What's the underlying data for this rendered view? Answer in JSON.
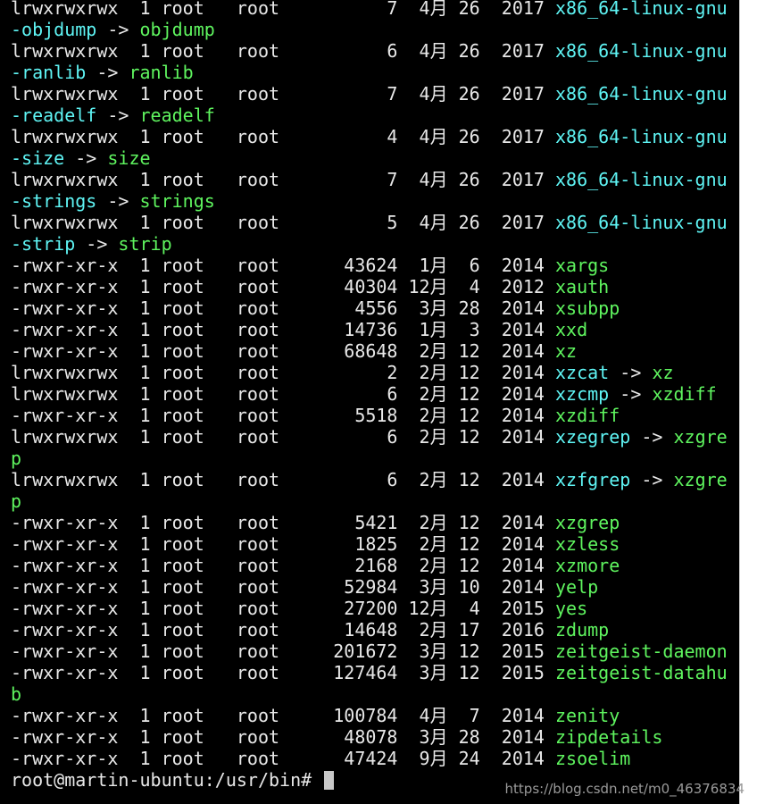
{
  "terminal": {
    "lines": [
      {
        "segments": [
          {
            "text": "lrwxrwxrwx  1 root   root          7  4月 26  2017 ",
            "color": "plain"
          },
          {
            "text": "x86_64-linux-gnu",
            "color": "cyan"
          }
        ]
      },
      {
        "segments": [
          {
            "text": "-objdump",
            "color": "cyan"
          },
          {
            "text": " -> ",
            "color": "plain"
          },
          {
            "text": "objdump",
            "color": "green"
          }
        ]
      },
      {
        "segments": [
          {
            "text": "lrwxrwxrwx  1 root   root          6  4月 26  2017 ",
            "color": "plain"
          },
          {
            "text": "x86_64-linux-gnu",
            "color": "cyan"
          }
        ]
      },
      {
        "segments": [
          {
            "text": "-ranlib",
            "color": "cyan"
          },
          {
            "text": " -> ",
            "color": "plain"
          },
          {
            "text": "ranlib",
            "color": "green"
          }
        ]
      },
      {
        "segments": [
          {
            "text": "lrwxrwxrwx  1 root   root          7  4月 26  2017 ",
            "color": "plain"
          },
          {
            "text": "x86_64-linux-gnu",
            "color": "cyan"
          }
        ]
      },
      {
        "segments": [
          {
            "text": "-readelf",
            "color": "cyan"
          },
          {
            "text": " -> ",
            "color": "plain"
          },
          {
            "text": "readelf",
            "color": "green"
          }
        ]
      },
      {
        "segments": [
          {
            "text": "lrwxrwxrwx  1 root   root          4  4月 26  2017 ",
            "color": "plain"
          },
          {
            "text": "x86_64-linux-gnu",
            "color": "cyan"
          }
        ]
      },
      {
        "segments": [
          {
            "text": "-size",
            "color": "cyan"
          },
          {
            "text": " -> ",
            "color": "plain"
          },
          {
            "text": "size",
            "color": "green"
          }
        ]
      },
      {
        "segments": [
          {
            "text": "lrwxrwxrwx  1 root   root          7  4月 26  2017 ",
            "color": "plain"
          },
          {
            "text": "x86_64-linux-gnu",
            "color": "cyan"
          }
        ]
      },
      {
        "segments": [
          {
            "text": "-strings",
            "color": "cyan"
          },
          {
            "text": " -> ",
            "color": "plain"
          },
          {
            "text": "strings",
            "color": "green"
          }
        ]
      },
      {
        "segments": [
          {
            "text": "lrwxrwxrwx  1 root   root          5  4月 26  2017 ",
            "color": "plain"
          },
          {
            "text": "x86_64-linux-gnu",
            "color": "cyan"
          }
        ]
      },
      {
        "segments": [
          {
            "text": "-strip",
            "color": "cyan"
          },
          {
            "text": " -> ",
            "color": "plain"
          },
          {
            "text": "strip",
            "color": "green"
          }
        ]
      },
      {
        "segments": [
          {
            "text": "-rwxr-xr-x  1 root   root      43624  1月  6  2014 ",
            "color": "plain"
          },
          {
            "text": "xargs",
            "color": "green"
          }
        ]
      },
      {
        "segments": [
          {
            "text": "-rwxr-xr-x  1 root   root      40304 12月  4  2012 ",
            "color": "plain"
          },
          {
            "text": "xauth",
            "color": "green"
          }
        ]
      },
      {
        "segments": [
          {
            "text": "-rwxr-xr-x  1 root   root       4556  3月 28  2014 ",
            "color": "plain"
          },
          {
            "text": "xsubpp",
            "color": "green"
          }
        ]
      },
      {
        "segments": [
          {
            "text": "-rwxr-xr-x  1 root   root      14736  1月  3  2014 ",
            "color": "plain"
          },
          {
            "text": "xxd",
            "color": "green"
          }
        ]
      },
      {
        "segments": [
          {
            "text": "-rwxr-xr-x  1 root   root      68648  2月 12  2014 ",
            "color": "plain"
          },
          {
            "text": "xz",
            "color": "green"
          }
        ]
      },
      {
        "segments": [
          {
            "text": "lrwxrwxrwx  1 root   root          2  2月 12  2014 ",
            "color": "plain"
          },
          {
            "text": "xzcat",
            "color": "cyan"
          },
          {
            "text": " -> ",
            "color": "plain"
          },
          {
            "text": "xz",
            "color": "green"
          }
        ]
      },
      {
        "segments": [
          {
            "text": "lrwxrwxrwx  1 root   root          6  2月 12  2014 ",
            "color": "plain"
          },
          {
            "text": "xzcmp",
            "color": "cyan"
          },
          {
            "text": " -> ",
            "color": "plain"
          },
          {
            "text": "xzdiff",
            "color": "green"
          }
        ]
      },
      {
        "segments": [
          {
            "text": "-rwxr-xr-x  1 root   root       5518  2月 12  2014 ",
            "color": "plain"
          },
          {
            "text": "xzdiff",
            "color": "green"
          }
        ]
      },
      {
        "segments": [
          {
            "text": "lrwxrwxrwx  1 root   root          6  2月 12  2014 ",
            "color": "plain"
          },
          {
            "text": "xzegrep",
            "color": "cyan"
          },
          {
            "text": " -> ",
            "color": "plain"
          },
          {
            "text": "xzgre",
            "color": "green"
          }
        ]
      },
      {
        "segments": [
          {
            "text": "p",
            "color": "green"
          }
        ]
      },
      {
        "segments": [
          {
            "text": "lrwxrwxrwx  1 root   root          6  2月 12  2014 ",
            "color": "plain"
          },
          {
            "text": "xzfgrep",
            "color": "cyan"
          },
          {
            "text": " -> ",
            "color": "plain"
          },
          {
            "text": "xzgre",
            "color": "green"
          }
        ]
      },
      {
        "segments": [
          {
            "text": "p",
            "color": "green"
          }
        ]
      },
      {
        "segments": [
          {
            "text": "-rwxr-xr-x  1 root   root       5421  2月 12  2014 ",
            "color": "plain"
          },
          {
            "text": "xzgrep",
            "color": "green"
          }
        ]
      },
      {
        "segments": [
          {
            "text": "-rwxr-xr-x  1 root   root       1825  2月 12  2014 ",
            "color": "plain"
          },
          {
            "text": "xzless",
            "color": "green"
          }
        ]
      },
      {
        "segments": [
          {
            "text": "-rwxr-xr-x  1 root   root       2168  2月 12  2014 ",
            "color": "plain"
          },
          {
            "text": "xzmore",
            "color": "green"
          }
        ]
      },
      {
        "segments": [
          {
            "text": "-rwxr-xr-x  1 root   root      52984  3月 10  2014 ",
            "color": "plain"
          },
          {
            "text": "yelp",
            "color": "green"
          }
        ]
      },
      {
        "segments": [
          {
            "text": "-rwxr-xr-x  1 root   root      27200 12月  4  2015 ",
            "color": "plain"
          },
          {
            "text": "yes",
            "color": "green"
          }
        ]
      },
      {
        "segments": [
          {
            "text": "-rwxr-xr-x  1 root   root      14648  2月 17  2016 ",
            "color": "plain"
          },
          {
            "text": "zdump",
            "color": "green"
          }
        ]
      },
      {
        "segments": [
          {
            "text": "-rwxr-xr-x  1 root   root     201672  3月 12  2015 ",
            "color": "plain"
          },
          {
            "text": "zeitgeist-daemon",
            "color": "green"
          }
        ]
      },
      {
        "segments": [
          {
            "text": "-rwxr-xr-x  1 root   root     127464  3月 12  2015 ",
            "color": "plain"
          },
          {
            "text": "zeitgeist-datahu",
            "color": "green"
          }
        ]
      },
      {
        "segments": [
          {
            "text": "b",
            "color": "green"
          }
        ]
      },
      {
        "segments": [
          {
            "text": "-rwxr-xr-x  1 root   root     100784  4月  7  2014 ",
            "color": "plain"
          },
          {
            "text": "zenity",
            "color": "green"
          }
        ]
      },
      {
        "segments": [
          {
            "text": "-rwxr-xr-x  1 root   root      48078  3月 28  2014 ",
            "color": "plain"
          },
          {
            "text": "zipdetails",
            "color": "green"
          }
        ]
      },
      {
        "segments": [
          {
            "text": "-rwxr-xr-x  1 root   root      47424  9月 24  2014 ",
            "color": "plain"
          },
          {
            "text": "zsoelim",
            "color": "green"
          }
        ]
      }
    ],
    "prompt": "root@martin-ubuntu:/usr/bin# "
  },
  "watermark": "https://blog.csdn.net/m0_46376834",
  "colors": {
    "background": "#000000",
    "plain": "#e8e8e8",
    "cyan": "#5ff5f5",
    "green": "#5ff55f"
  }
}
